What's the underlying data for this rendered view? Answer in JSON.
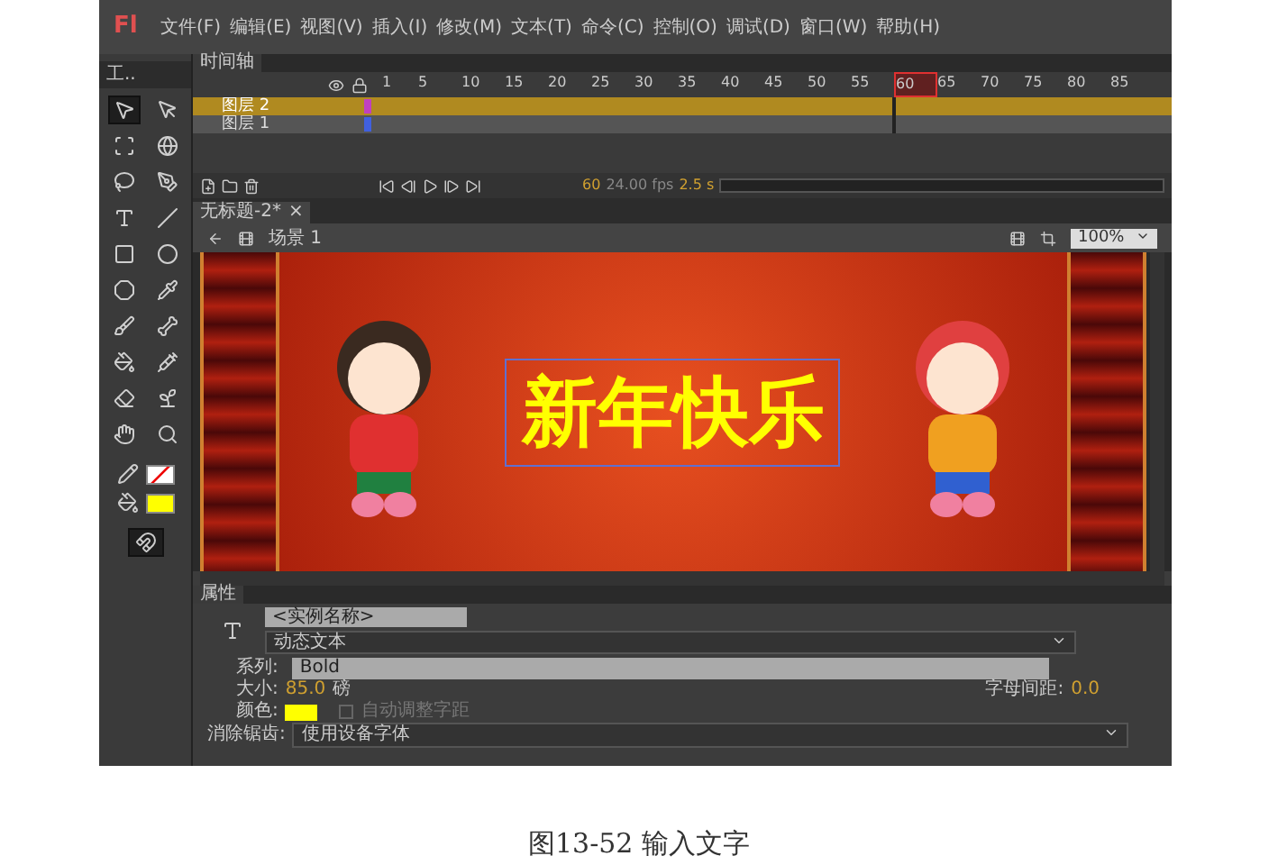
{
  "app": {
    "logo": "Fl",
    "menu": [
      "文件(F)",
      "编辑(E)",
      "视图(V)",
      "插入(I)",
      "修改(M)",
      "文本(T)",
      "命令(C)",
      "控制(O)",
      "调试(D)",
      "窗口(W)",
      "帮助(H)"
    ]
  },
  "tools_panel": {
    "title": "工..",
    "tools": [
      {
        "selected": true
      },
      {
        "selected": false
      },
      {
        "selected": false
      },
      {
        "selected": false
      },
      {
        "selected": false
      },
      {
        "selected": false
      },
      {
        "selected": false
      },
      {
        "selected": false
      },
      {
        "selected": false
      },
      {
        "selected": false
      },
      {
        "selected": false
      },
      {
        "selected": false
      },
      {
        "selected": false
      },
      {
        "selected": false
      },
      {
        "selected": false
      },
      {
        "selected": false
      },
      {
        "selected": false
      },
      {
        "selected": false
      },
      {
        "selected": false
      },
      {
        "selected": false
      }
    ],
    "fill": {
      "color": "#ffff00"
    },
    "snap": {
      "selected": true
    }
  },
  "timeline": {
    "title": "时间轴",
    "frames": [
      {
        "label": "1",
        "selected": false
      },
      {
        "label": "5",
        "selected": false
      },
      {
        "label": "10",
        "selected": false
      },
      {
        "label": "15",
        "selected": false
      },
      {
        "label": "20",
        "selected": false
      },
      {
        "label": "25",
        "selected": false
      },
      {
        "label": "30",
        "selected": false
      },
      {
        "label": "35",
        "selected": false
      },
      {
        "label": "40",
        "selected": false
      },
      {
        "label": "45",
        "selected": false
      },
      {
        "label": "50",
        "selected": false
      },
      {
        "label": "55",
        "selected": false
      },
      {
        "label": "60",
        "selected": true
      },
      {
        "label": "65",
        "selected": false
      },
      {
        "label": "70",
        "selected": false
      },
      {
        "label": "75",
        "selected": false
      },
      {
        "label": "80",
        "selected": false
      },
      {
        "label": "85",
        "selected": false
      }
    ],
    "layers": [
      {
        "name": "图层 2",
        "selected": true,
        "color": "#c040c0"
      },
      {
        "name": "图层 1",
        "selected": false,
        "color": "#4060e0"
      }
    ],
    "current_frame": "60",
    "fps": "24.00 fps",
    "time": "2.5 s"
  },
  "document": {
    "tab": "无标题-2*",
    "close": "×",
    "scene": "场景 1",
    "zoom": "100%",
    "stage_text": "新年快乐"
  },
  "properties": {
    "title": "属性",
    "instance_name": "<实例名称>",
    "text_type": "动态文本",
    "family_label": "系列:",
    "family": "Bold",
    "size_label": "大小:",
    "size": "85.0",
    "size_unit": "磅",
    "spacing_label": "字母间距:",
    "spacing": "0.0",
    "color_label": "颜色:",
    "color": "#ffff00",
    "auto_kern": {
      "label": "自动调整字距",
      "checked": false
    },
    "antialias_label": "消除锯齿:",
    "antialias": "使用设备字体"
  },
  "caption": "图13-52 输入文字"
}
